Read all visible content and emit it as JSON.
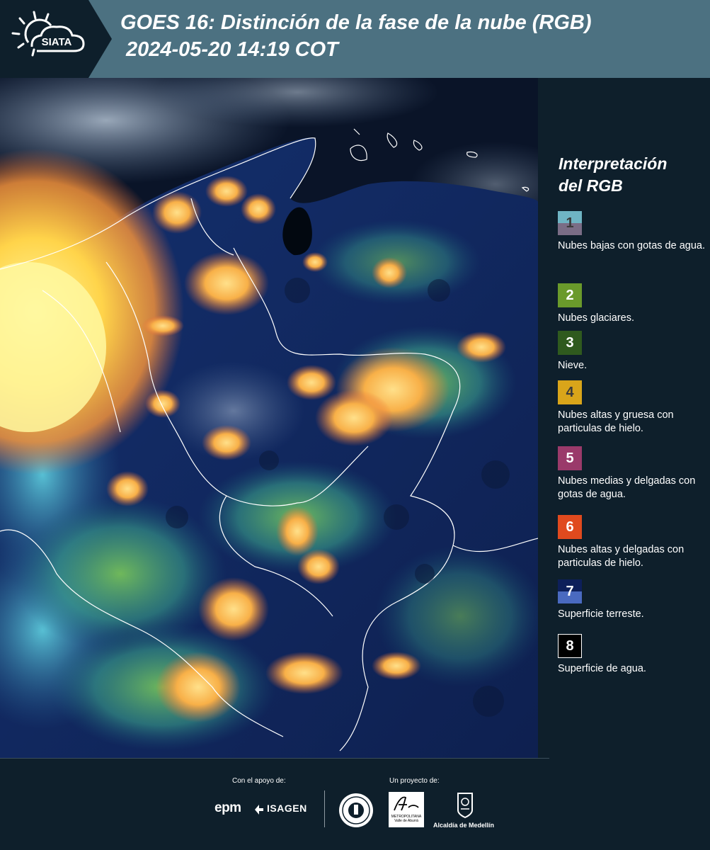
{
  "header": {
    "logo_text": "SIATA",
    "title": "GOES 16: Distinción de la fase de la nube (RGB)",
    "datetime": "2024-05-20 14:19 COT"
  },
  "legend": {
    "title_line1": "Interpretación",
    "title_line2": "del RGB",
    "items": [
      {
        "number": "1",
        "label": "Nubes bajas con gotas de agua.",
        "color_top": "#6fb4c4",
        "color_bottom": "#7a6d86",
        "number_color": "#3a3a3a"
      },
      {
        "number": "2",
        "label": "Nubes glaciares.",
        "color_top": "#6a9a2b",
        "color_bottom": "#6a9a2b",
        "number_color": "#ffffff"
      },
      {
        "number": "3",
        "label": "Nieve.",
        "color_top": "#2f5a1e",
        "color_bottom": "#2f5a1e",
        "number_color": "#ffffff"
      },
      {
        "number": "4",
        "label": "Nubes altas y gruesa con particulas de hielo.",
        "color_top": "#d9a51a",
        "color_bottom": "#d9a51a",
        "number_color": "#3a3a3a"
      },
      {
        "number": "5",
        "label": "Nubes medias y delgadas con gotas de agua.",
        "color_top": "#9a3a6a",
        "color_bottom": "#9a3a6a",
        "number_color": "#ffffff"
      },
      {
        "number": "6",
        "label": "Nubes altas y delgadas con particulas de hielo.",
        "color_top": "#e04a1e",
        "color_bottom": "#e04a1e",
        "number_color": "#ffffff"
      },
      {
        "number": "7",
        "label": "Superficie terreste.",
        "color_top": "#0d1f5a",
        "color_bottom": "#4a6ac0",
        "number_color": "#ffffff"
      },
      {
        "number": "8",
        "label": "Superficie de agua.",
        "color_top": "#000000",
        "color_bottom": "#000000",
        "number_color": "#ffffff"
      }
    ]
  },
  "footer": {
    "support_label": "Con el apoyo de:",
    "project_label": "Un proyecto de:",
    "sponsor1": "epm",
    "sponsor2": "ISAGEN",
    "area_logo_text": "METROPOLITANA Valle de Aburrá",
    "medellin_label": "Alcaldía de Medellín"
  },
  "colors": {
    "header_bg": "#4c7181",
    "panel_bg": "#0e1f2b",
    "ocean": "#0b1530"
  }
}
